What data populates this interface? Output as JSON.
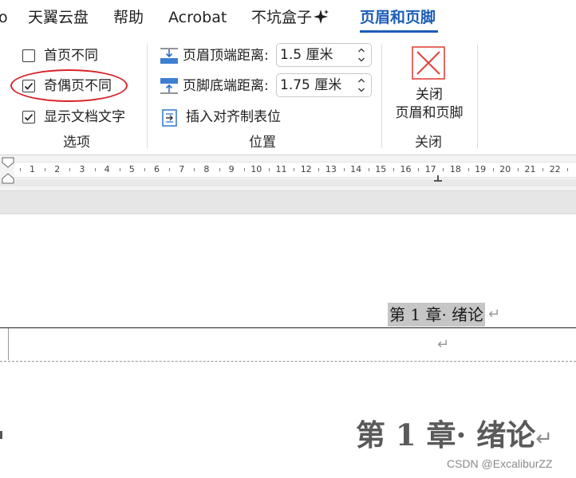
{
  "menu": {
    "tabs": [
      {
        "label": "o"
      },
      {
        "label": "天翼云盘"
      },
      {
        "label": "帮助"
      },
      {
        "label": "Acrobat"
      },
      {
        "label": "不坑盒子"
      },
      {
        "label": "页眉和页脚"
      }
    ],
    "active_tab": "页眉和页脚",
    "accent_color": "#1b5db8"
  },
  "ribbon": {
    "options_group": {
      "label": "选项",
      "checkboxes": [
        {
          "label": "首页不同",
          "checked": false
        },
        {
          "label": "奇偶页不同",
          "checked": true
        },
        {
          "label": "显示文档文字",
          "checked": true
        }
      ],
      "highlight_color": "#d8232a"
    },
    "position_group": {
      "label": "位置",
      "header_distance": {
        "label": "页眉顶端距离:",
        "value": "1.5 厘米"
      },
      "footer_distance": {
        "label": "页脚底端距离:",
        "value": "1.75 厘米"
      },
      "insert_tab": {
        "label": "插入对齐制表位"
      }
    },
    "close_group": {
      "label": "关闭",
      "close_button": {
        "label_line1": "关闭",
        "label_line2": "页眉和页脚"
      }
    }
  },
  "ruler": {
    "numbers": [
      "1",
      "2",
      "3",
      "4",
      "5",
      "6",
      "7",
      "8",
      "9",
      "10",
      "11",
      "12",
      "13",
      "14",
      "15",
      "16",
      "17",
      "18",
      "19",
      "20",
      "21",
      "22"
    ]
  },
  "document": {
    "header_text": "第 1 章· 绪论",
    "heading": "第 1 章· 绪论",
    "paragraph_mark": "↵"
  },
  "watermark": "CSDN @ExcaliburZZ"
}
